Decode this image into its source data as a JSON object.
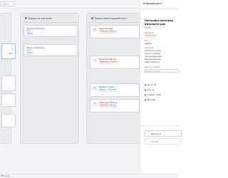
{
  "topbar": {
    "chip_text": "Отката"
  },
  "columns": {
    "left": {
      "cards": [
        {
          "line1": "я",
          "line2": "ной",
          "line3": ""
        },
        {
          "line1": "...",
          "line2": ""
        },
        {
          "line1": "",
          "line2": ""
        }
      ]
    },
    "middle": {
      "header": "Задачи на контроле",
      "cards": [
        {
          "title": "Задача из Бэклога",
          "id": "LB-12",
          "badge": "Бэклог"
        },
        {
          "title": "Задача из Бэклога",
          "id": "LB-11",
          "badge": "Бэклог"
        }
      ]
    },
    "right": {
      "header": "Задачи моих подчинённых",
      "cards": [
        {
          "avatar": "АП",
          "name": "Анна Петрова",
          "badge1": "Просрочено",
          "badge2": "Бэклог"
        },
        {
          "avatar": "ДС",
          "name": "Дмитрий Сидоров",
          "badge1": "Просрочено",
          "badge2": "В работе"
        },
        {
          "avatar": "МК",
          "name": "Мария Козлова",
          "badge1": "Бэклог",
          "badge2": "Выполнено"
        },
        {
          "avatar": "АВ",
          "name": "Александр Волков",
          "badge1": "Просрочено",
          "badge2": "Бэклог"
        }
      ]
    }
  },
  "panel": {
    "title": "Информация о",
    "task_title_line1": "Настройка интеграц",
    "task_title_line2": "Битрикс24 для",
    "task_id": "LB-123",
    "priority_label": "Приоритет",
    "priority_value": "Критический",
    "type_label": "Тип",
    "type_value": "Задача",
    "description_label": "Описание",
    "description_lines": [
      "Необходимо настро",
      "процессом продаж",
      "синхронизацию дан",
      "функций. Включает",
      "лиды и сделки в р"
    ],
    "reason_label": "Зачем это делать",
    "reason_placeholder": "Введите описан",
    "author_label": "Автор:",
    "author_value": "Ив",
    "executor_label": "Исп.:",
    "executor_value": "Д",
    "created_label": "Создано:",
    "created_value": "2025",
    "deadline_label": "Дедлайн:",
    "deadline_value": "",
    "primary_button": "Вернуть в",
    "secondary_button": "Отмена"
  },
  "statusbar": {
    "text": "787 часов"
  }
}
